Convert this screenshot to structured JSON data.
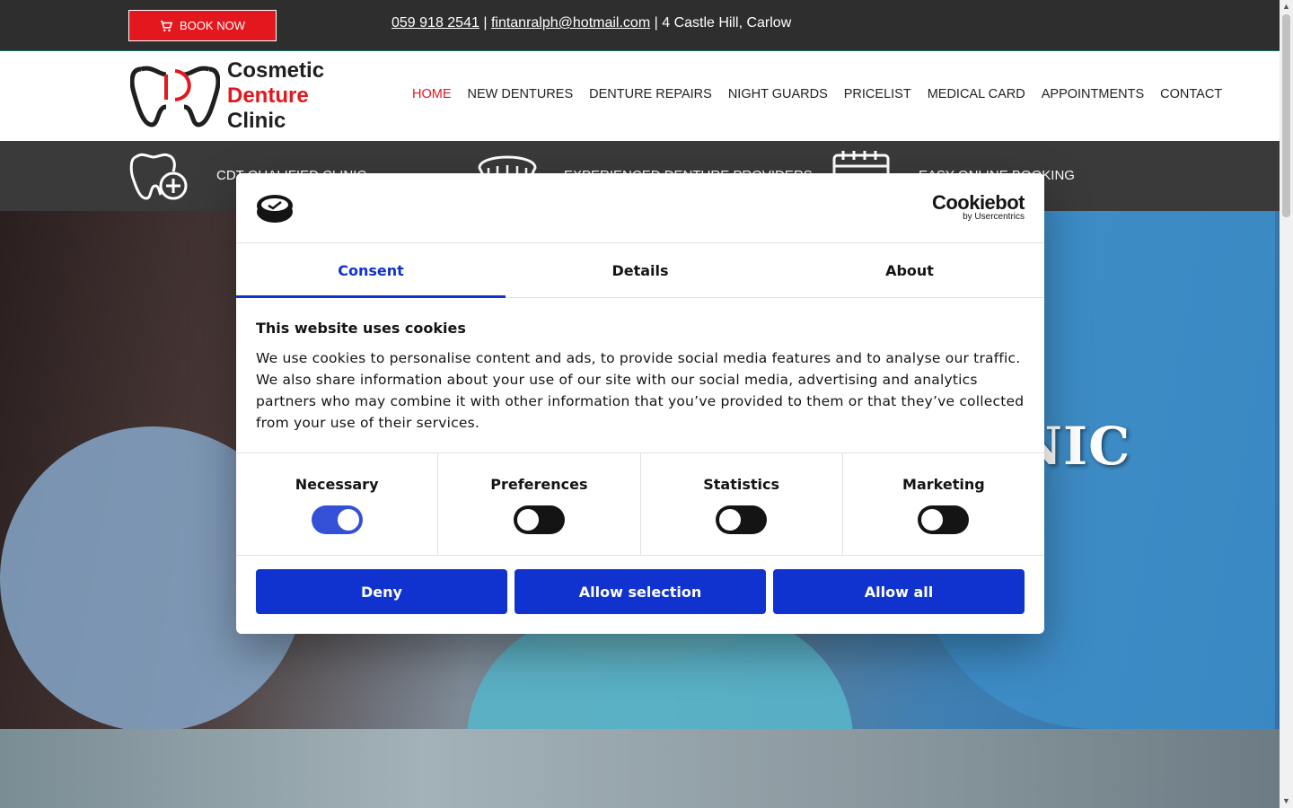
{
  "topbar": {
    "book_label": "BOOK NOW",
    "phone": "059 918 2541",
    "email": "fintanralph@hotmail.com",
    "address": "4 Castle Hill, Carlow",
    "separator": "|"
  },
  "logo": {
    "line1": "Cosmetic",
    "line2": "Denture",
    "line3": "Clinic"
  },
  "nav": {
    "items": [
      "HOME",
      "NEW DENTURES",
      "DENTURE REPAIRS",
      "NIGHT GUARDS",
      "PRICELIST",
      "MEDICAL CARD",
      "APPOINTMENTS",
      "CONTACT"
    ],
    "active": "HOME"
  },
  "features": [
    {
      "icon": "tooth-plus-icon",
      "label": "CDT QUALIFIED CLINIC"
    },
    {
      "icon": "denture-icon",
      "label": "EXPERIENCED DENTURE PROVIDERS"
    },
    {
      "icon": "calendar-icon",
      "label": "EASY ONLINE BOOKING"
    }
  ],
  "hero": {
    "title_fragment": "NIC"
  },
  "cookie": {
    "brand": "Cookiebot",
    "brand_sub": "by Usercentrics",
    "tabs": [
      "Consent",
      "Details",
      "About"
    ],
    "active_tab": "Consent",
    "title": "This website uses cookies",
    "text": "We use cookies to personalise content and ads, to provide social media features and to analyse our traffic. We also share information about your use of our site with our social media, advertising and analytics partners who may combine it with other information that you’ve provided to them or that they’ve collected from your use of their services.",
    "toggles": [
      {
        "label": "Necessary",
        "on": true
      },
      {
        "label": "Preferences",
        "on": false
      },
      {
        "label": "Statistics",
        "on": false
      },
      {
        "label": "Marketing",
        "on": false
      }
    ],
    "buttons": {
      "deny": "Deny",
      "allow_selection": "Allow selection",
      "allow_all": "Allow all"
    }
  },
  "colors": {
    "brand_red": "#e3171e",
    "cookie_blue": "#1032cf",
    "topbar": "#2e2e2e"
  }
}
